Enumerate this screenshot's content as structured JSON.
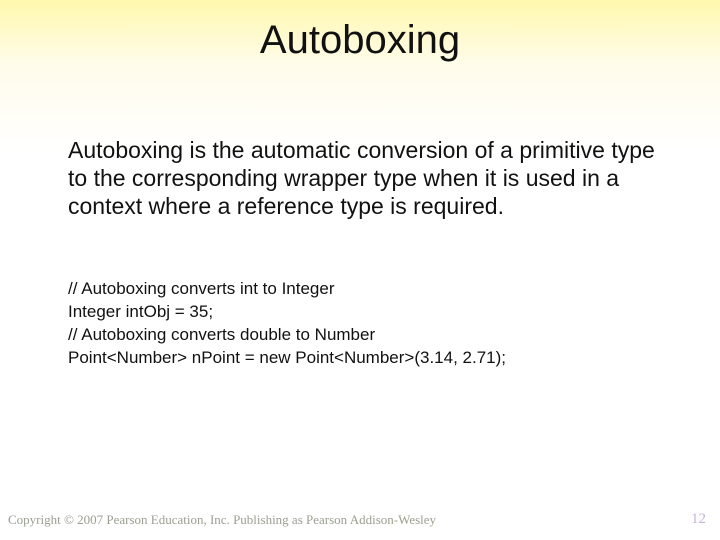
{
  "title": "Autoboxing",
  "body": "Autoboxing is the automatic conversion of a primitive type to the corresponding wrapper type when it is used in a context where a reference type is required.",
  "code": {
    "l1": "// Autoboxing converts int to Integer",
    "l2": "Integer intObj = 35;",
    "l3": "// Autoboxing converts double to Number",
    "l4": "Point<Number> nPoint = new Point<Number>(3.14, 2.71);"
  },
  "footer": "Copyright © 2007 Pearson Education, Inc. Publishing as Pearson Addison-Wesley",
  "page": "12"
}
